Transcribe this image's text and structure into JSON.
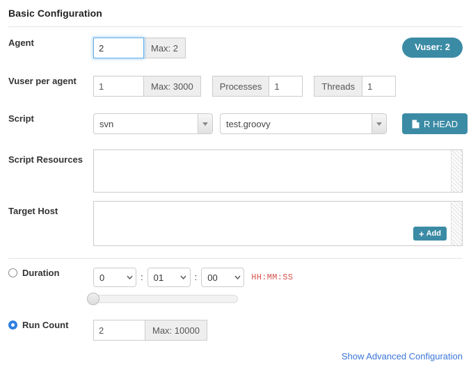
{
  "section": {
    "title": "Basic Configuration"
  },
  "agent": {
    "label": "Agent",
    "value": "2",
    "max_addon": "Max: 2",
    "badge": "Vuser: 2"
  },
  "vuser_per_agent": {
    "label": "Vuser per agent",
    "value": "1",
    "max_addon": "Max: 3000",
    "processes_label": "Processes",
    "processes_value": "1",
    "threads_label": "Threads",
    "threads_value": "1"
  },
  "script": {
    "label": "Script",
    "scm_selected": "svn",
    "file_selected": "test.groovy",
    "head_button": "R HEAD",
    "head_icon": "document-icon"
  },
  "script_resources": {
    "label": "Script Resources",
    "value": ""
  },
  "target_host": {
    "label": "Target Host",
    "value": "",
    "add_button": "Add",
    "add_icon": "plus-icon"
  },
  "duration": {
    "label": "Duration",
    "selected": false,
    "hours": "0",
    "minutes": "01",
    "seconds": "00",
    "format_hint": "HH:MM:SS",
    "slider_percent": 0
  },
  "run_count": {
    "label": "Run Count",
    "selected": true,
    "value": "2",
    "max_addon": "Max: 10000"
  },
  "footer": {
    "advanced_link": "Show Advanced Configuration"
  },
  "colors": {
    "teal": "#3b8ba5",
    "link_blue": "#3a76d8",
    "focus_blue": "#66afe9",
    "hint_red": "#d9534f",
    "radio_blue": "#2f7fe0"
  }
}
